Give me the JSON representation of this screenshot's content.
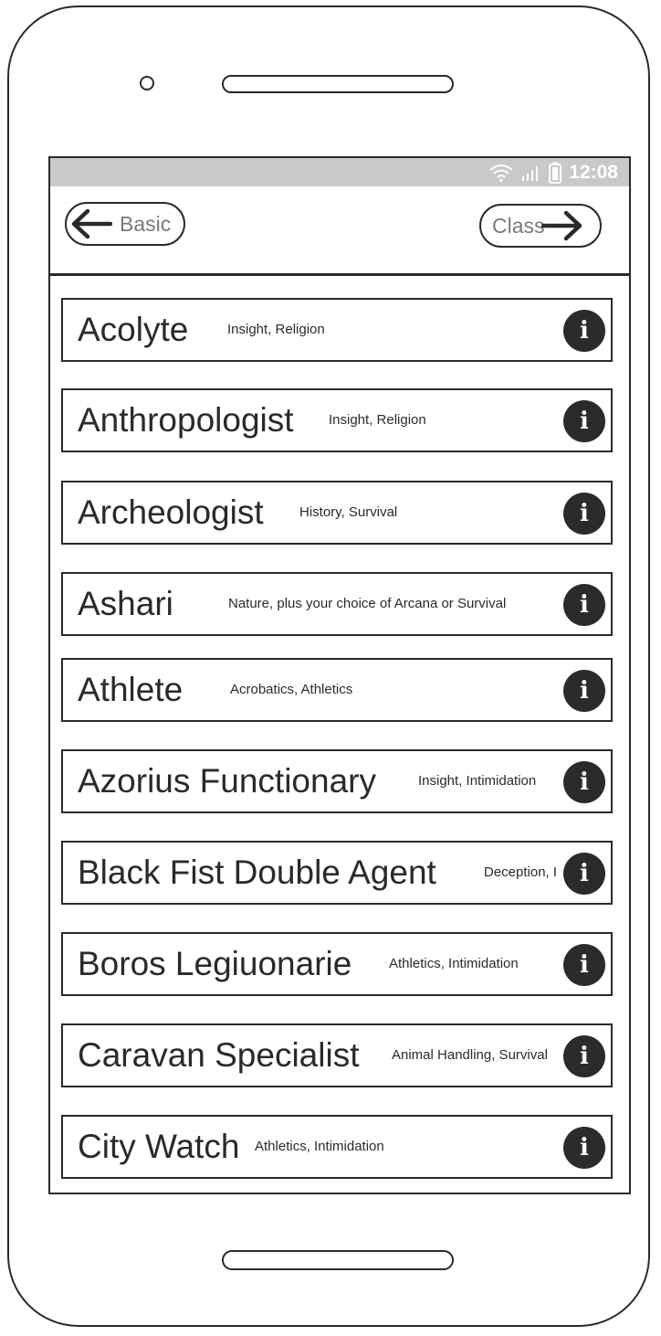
{
  "status_bar": {
    "time": "12:08",
    "icons": [
      "wifi-icon",
      "signal-icon",
      "battery-icon"
    ]
  },
  "nav": {
    "back_label": "Basic",
    "next_label": "Class"
  },
  "backgrounds": [
    {
      "name": "Acolyte",
      "skills": "Insight, Religion"
    },
    {
      "name": "Anthropologist",
      "skills": "Insight, Religion"
    },
    {
      "name": "Archeologist",
      "skills": "History, Survival"
    },
    {
      "name": "Ashari",
      "skills": "Nature, plus your choice of Arcana or Survival"
    },
    {
      "name": "Athlete",
      "skills": "Acrobatics, Athletics"
    },
    {
      "name": "Azorius Functionary",
      "skills": "Insight, Intimidation"
    },
    {
      "name": "Black Fist Double Agent",
      "skills": "Deception, I"
    },
    {
      "name": "Boros Legiuonarie",
      "skills": "Athletics, Intimidation"
    },
    {
      "name": "Caravan Specialist",
      "skills": "Animal Handling, Survival"
    },
    {
      "name": "City Watch",
      "skills": "Athletics, Intimidation"
    }
  ],
  "info_glyph": "i"
}
